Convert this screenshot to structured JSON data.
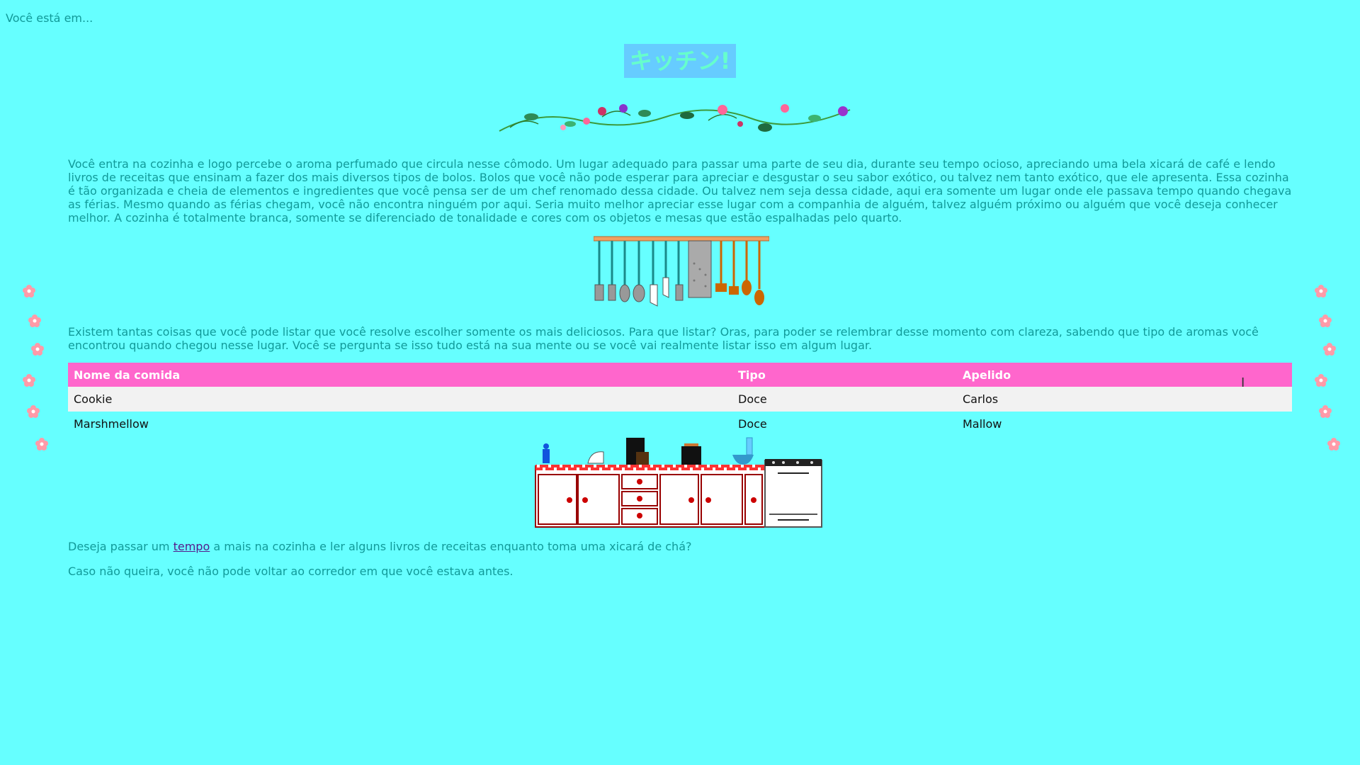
{
  "breadcrumb": "Você está em...",
  "title": "キッチン!",
  "intro": "Você entra na cozinha e logo percebe o aroma perfumado que circula nesse cômodo. Um lugar adequado para passar uma parte de seu dia, durante seu tempo ocioso, apreciando uma bela xicará de café e lendo livros de receitas que ensinam a fazer dos mais diversos tipos de bolos. Bolos que você não pode esperar para apreciar e desgustar o seu sabor exótico, ou talvez nem tanto exótico, que ele apresenta. Essa cozinha é tão organizada e cheia de elementos e ingredientes que você pensa ser de um chef renomado dessa cidade. Ou talvez nem seja dessa cidade, aqui era somente um lugar onde ele passava tempo quando chegava as férias. Mesmo quando as férias chegam, você não encontra ninguém por aqui. Seria muito melhor apreciar esse lugar com a companhia de alguém, talvez alguém próximo ou alguém que você deseja conhecer melhor. A cozinha é totalmente branca, somente se diferenciado de tonalidade e cores com os objetos e mesas que estão espalhadas pelo quarto.",
  "list_intro": "Existem tantas coisas que você pode listar que você resolve escolher somente os mais deliciosos. Para que listar? Oras, para poder se relembrar desse momento com clareza, sabendo que tipo de aromas você encontrou quando chegou nesse lugar. Você se pergunta se isso tudo está na sua mente ou se você vai realmente listar isso em algum lugar.",
  "table": {
    "headers": [
      "Nome da comida",
      "Tipo",
      "Apelido"
    ],
    "rows": [
      [
        "Cookie",
        "Doce",
        "Carlos"
      ],
      [
        "Marshmellow",
        "Doce",
        "Mallow"
      ]
    ]
  },
  "question": {
    "before": "Deseja passar um ",
    "link": "tempo",
    "after": " a mais na cozinha e ler alguns livros de receitas enquanto toma uma xicará de chá?"
  },
  "closing": "Caso não queira, você não pode voltar ao corredor em que você estava antes.",
  "colors": {
    "background": "#66ffff",
    "text": "#119a99",
    "table_header": "#ff66cc",
    "title_bg": "#66ccff",
    "title_text": "#66ffcc"
  },
  "icons": [
    "flower-vine-decoration",
    "hanging-utensils-illustration",
    "kitchen-counter-illustration",
    "pink-flower-icon",
    "text-cursor-icon"
  ]
}
